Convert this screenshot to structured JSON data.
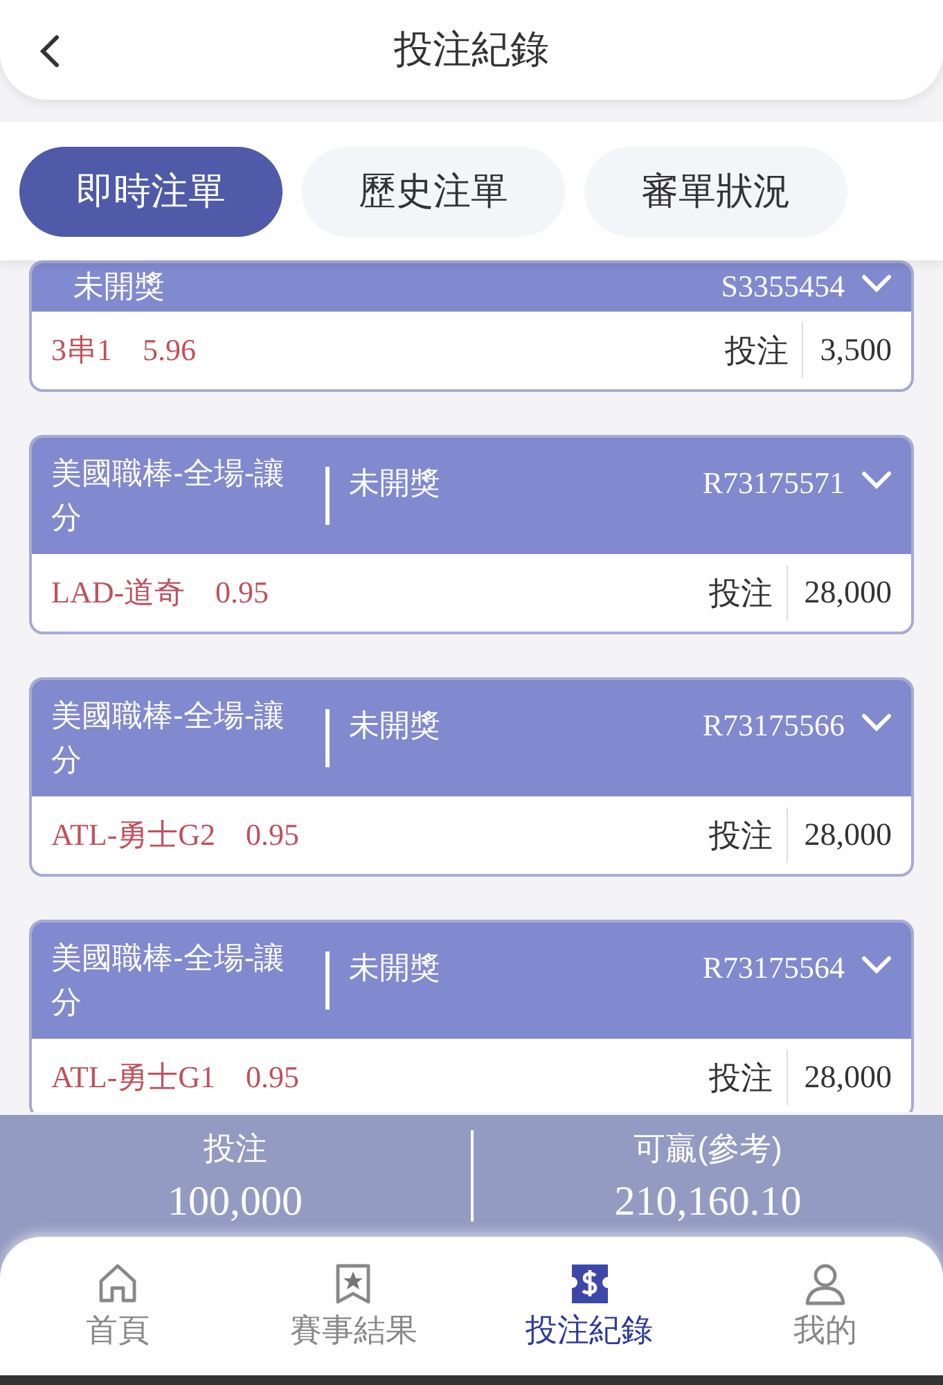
{
  "header": {
    "title": "投注紀錄"
  },
  "tabs": [
    {
      "label": "即時注單",
      "selected": true
    },
    {
      "label": "歷史注單",
      "selected": false
    },
    {
      "label": "審單狀況",
      "selected": false
    }
  ],
  "bets": [
    {
      "status": "未開獎",
      "order_id": "S3355454",
      "selection": "3串1",
      "odds": "5.96",
      "stake_label": "投注",
      "stake": "3,500"
    },
    {
      "league": "美國職棒-全場-讓分",
      "status": "未開獎",
      "order_id": "R73175571",
      "selection": "LAD-道奇",
      "odds": "0.95",
      "stake_label": "投注",
      "stake": "28,000"
    },
    {
      "league": "美國職棒-全場-讓分",
      "status": "未開獎",
      "order_id": "R73175566",
      "selection": "ATL-勇士G2",
      "odds": "0.95",
      "stake_label": "投注",
      "stake": "28,000"
    },
    {
      "league": "美國職棒-全場-讓分",
      "status": "未開獎",
      "order_id": "R73175564",
      "selection": "ATL-勇士G1",
      "odds": "0.95",
      "stake_label": "投注",
      "stake": "28,000"
    }
  ],
  "summary": [
    {
      "label": "投注",
      "value": "100,000"
    },
    {
      "label": "可贏(參考)",
      "value": "210,160.10"
    }
  ],
  "nav": [
    {
      "kind": "home",
      "label": "首頁",
      "selected": false
    },
    {
      "kind": "results",
      "label": "賽事結果",
      "selected": false
    },
    {
      "kind": "records",
      "label": "投注紀錄",
      "selected": true
    },
    {
      "kind": "profile",
      "label": "我的",
      "selected": false
    }
  ]
}
